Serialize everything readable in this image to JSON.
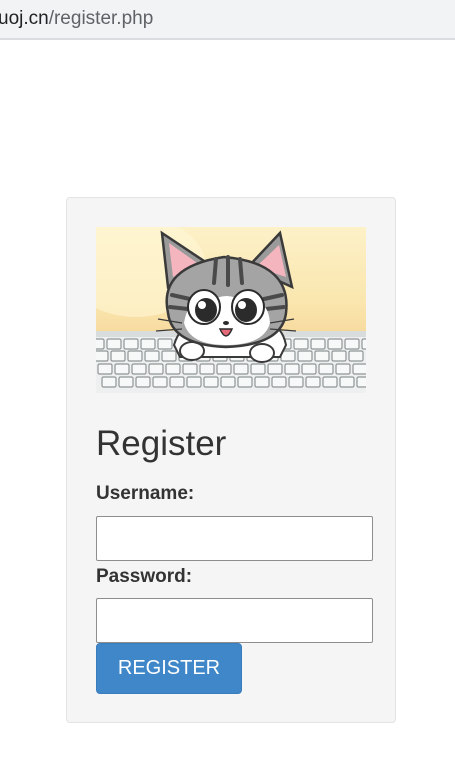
{
  "browser": {
    "url_host": "uoj.cn",
    "url_path": "/register.php"
  },
  "form": {
    "title": "Register",
    "username_label": "Username:",
    "username_value": "",
    "password_label": "Password:",
    "password_value": "",
    "submit_label": "REGISTER"
  },
  "banner": {
    "icon": "cat-on-keyboard-illustration"
  },
  "colors": {
    "button": "#3f87c9",
    "card_background": "#f5f5f5",
    "address_bar": "#f1f3f4"
  }
}
